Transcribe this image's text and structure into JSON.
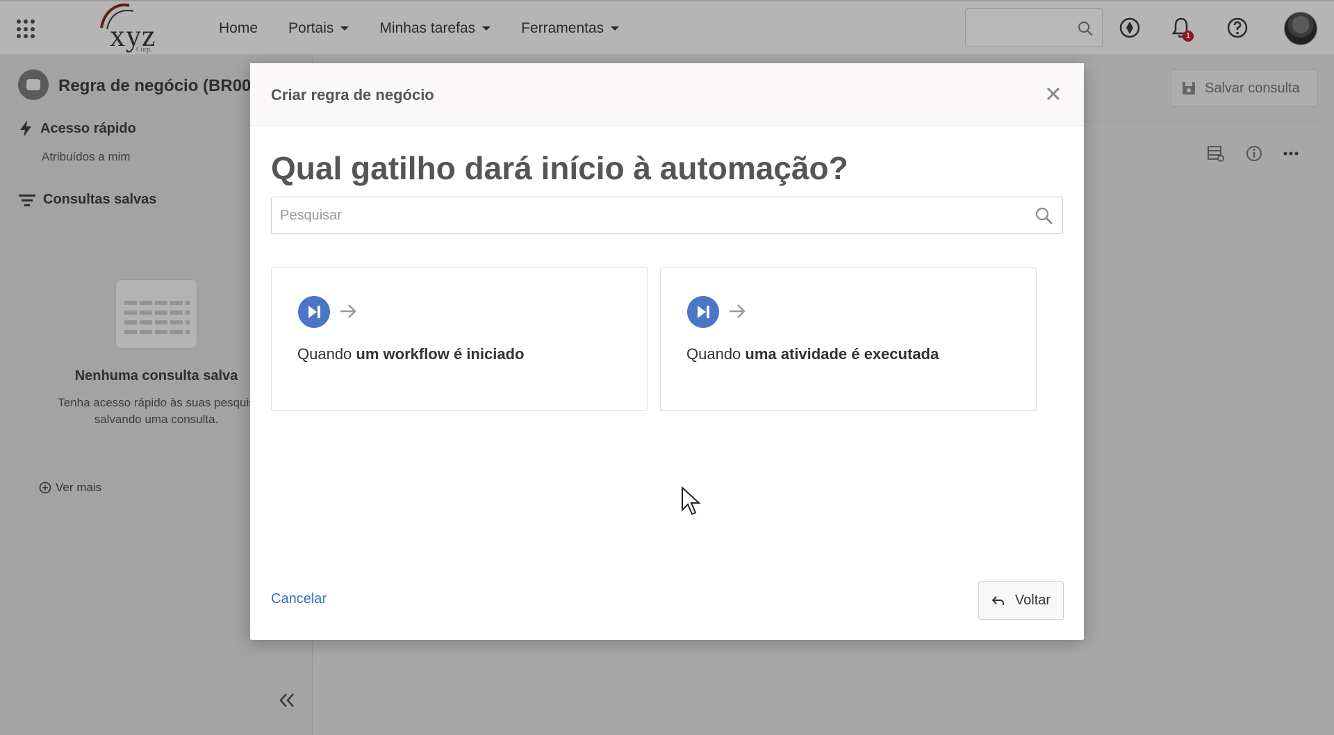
{
  "topbar": {
    "logo_text": "xyz",
    "logo_sub": "Corp.",
    "nav": [
      {
        "label": "Home",
        "has_caret": false
      },
      {
        "label": "Portais",
        "has_caret": true
      },
      {
        "label": "Minhas tarefas",
        "has_caret": true
      },
      {
        "label": "Ferramentas",
        "has_caret": true
      }
    ],
    "search_placeholder": "",
    "notification_count": "1",
    "icons": [
      "apps-grid-icon",
      "search-icon",
      "compass-icon",
      "bell-icon",
      "help-icon",
      "avatar"
    ]
  },
  "sidebar": {
    "title": "Regra de negócio (BR00",
    "quick_access": "Acesso rápido",
    "assigned_to_me": "Atribuídos a mim",
    "saved_queries": "Consultas salvas",
    "empty_title": "Nenhuma consulta salva",
    "empty_desc": "Tenha acesso rápido às suas pesquis salvando uma consulta.",
    "see_more": "Ver mais"
  },
  "main": {
    "save_query": "Salvar consulta"
  },
  "modal": {
    "title": "Criar regra de negócio",
    "question": "Qual gatilho dará início à automação?",
    "search_placeholder": "Pesquisar",
    "cards": [
      {
        "prefix": "Quando ",
        "bold": "um workflow é iniciado"
      },
      {
        "prefix": "Quando ",
        "bold": "uma atividade é executada"
      }
    ],
    "cancel": "Cancelar",
    "back": "Voltar"
  },
  "colors": {
    "accent": "#4a76c4",
    "link": "#3a6fb5",
    "badge": "#8a1a1a"
  }
}
